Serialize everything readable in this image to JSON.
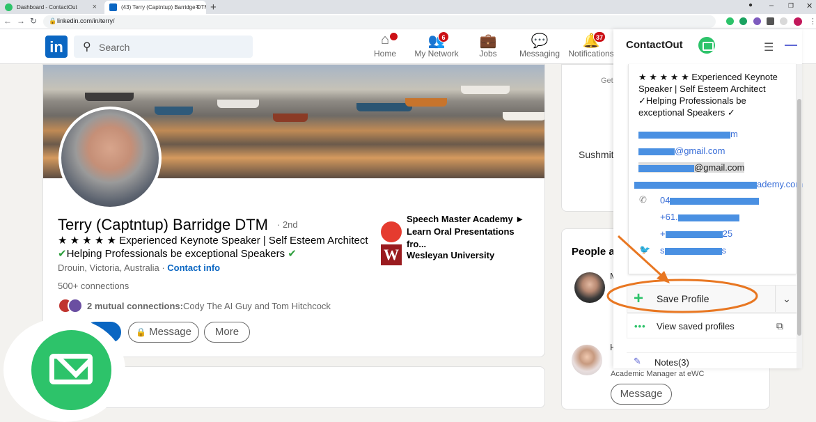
{
  "browser": {
    "tabs": [
      {
        "title": "Dashboard - ContactOut"
      },
      {
        "title": "(43) Terry (Captntup) Barridge DTM"
      }
    ],
    "url": "linkedin.com/in/terry/"
  },
  "linkedin": {
    "search_placeholder": "Search",
    "nav": [
      {
        "label": "Home",
        "icon": "home-icon",
        "badge": ""
      },
      {
        "label": "My Network",
        "icon": "network-icon",
        "badge": "6"
      },
      {
        "label": "Jobs",
        "icon": "jobs-icon",
        "badge": ""
      },
      {
        "label": "Messaging",
        "icon": "messaging-icon",
        "badge": ""
      },
      {
        "label": "Notifications",
        "icon": "bell-icon",
        "badge": "37"
      }
    ]
  },
  "profile": {
    "name": "Terry (Captntup) Barridge DTM",
    "degree": "· 2nd",
    "headline_line1": "★ ★ ★ ★ ★ Experienced Keynote Speaker | Self Esteem Architect",
    "headline_line2": "Helping Professionals be exceptional Speakers",
    "location": "Drouin, Victoria, Australia",
    "location_sep": " · ",
    "contact_info": "Contact info",
    "connections": "500+ connections",
    "mutual_bold": "2 mutual connections:",
    "mutual_names": " Cody The AI Guy and Tom Hitchcock",
    "buttons": {
      "message": "Message",
      "more": "More"
    },
    "experience": [
      {
        "name": "Speech Master Academy ► Learn Oral Presentations fro...",
        "logo": "speech-master-logo"
      },
      {
        "name": "Wesleyan University",
        "logo_letter": "W"
      }
    ]
  },
  "sidebar": {
    "card1_partial": "Get",
    "card1_name": "Sushmit",
    "people_title": "People al",
    "person1_partial": "M",
    "person2_partial": "H",
    "person2_job": "Academic Manager at eWC",
    "message_button": "Message"
  },
  "contactout": {
    "brand": "ContactOut",
    "bio": "★ ★ ★ ★ ★ Experienced Keynote Speaker | Self Esteem Architect ✓Helping Professionals be exceptional Speakers ✓",
    "emails": [
      {
        "visible_suffix": "m",
        "icon": ""
      },
      {
        "visible_suffix": "@gmail.com",
        "icon": ""
      },
      {
        "visible_suffix": "@gmail.com",
        "icon": ""
      },
      {
        "visible_suffix": "ademy.com",
        "icon": ""
      }
    ],
    "phones": [
      {
        "visible_prefix": "04",
        "icon": "phone-icon"
      },
      {
        "visible_prefix": "+61.",
        "icon": ""
      },
      {
        "visible_prefix": "+",
        "visible_suffix": "25",
        "icon": ""
      }
    ],
    "twitter": {
      "visible_prefix": "s",
      "visible_suffix": "s",
      "icon": "twitter-icon"
    },
    "save_profile": "Save Profile",
    "view_saved": "View saved profiles",
    "notes": "Notes(3)"
  },
  "colors": {
    "linkedin_blue": "#0a66c2",
    "contactout_green": "#2dc36a",
    "annotation_orange": "#e87722",
    "email_link": "#3a6fd8",
    "redaction": "#4a90e2"
  }
}
